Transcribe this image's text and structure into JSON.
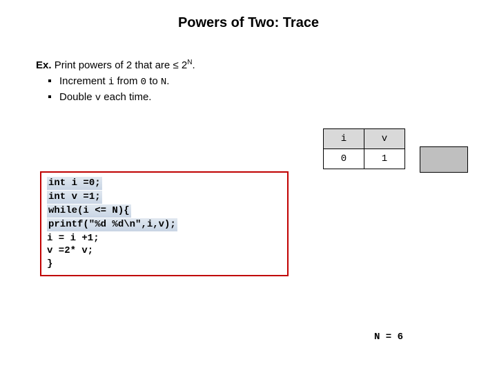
{
  "title": "Powers of Two:  Trace",
  "ex": {
    "label": "Ex.",
    "text_before": "Print powers of 2 that are ",
    "leq": "≤",
    "base": "2",
    "exp": "N",
    "period": "."
  },
  "bullets": [
    {
      "pre": "Increment ",
      "code1": "i",
      "mid": " from ",
      "code2": "0",
      "mid2": " to ",
      "code3": "N",
      "post": "."
    },
    {
      "pre": "Double ",
      "code1": "v",
      "mid": " each time.",
      "code2": "",
      "mid2": "",
      "code3": "",
      "post": ""
    }
  ],
  "code": {
    "l1a": "int",
    "l1b": " i =0;",
    "l2a": "int",
    "l2b": " v =1;",
    "l3a": "while",
    "l3b": "(i <= N){",
    "l4": "printf(\"%d %d\\n\",i,v);",
    "l5": "  i = i +1;",
    "l6": "v =2* v;",
    "l7": "}"
  },
  "table": {
    "h1": "i",
    "h2": "v",
    "r1c1": "0",
    "r1c2": "1"
  },
  "nline": "N = 6"
}
